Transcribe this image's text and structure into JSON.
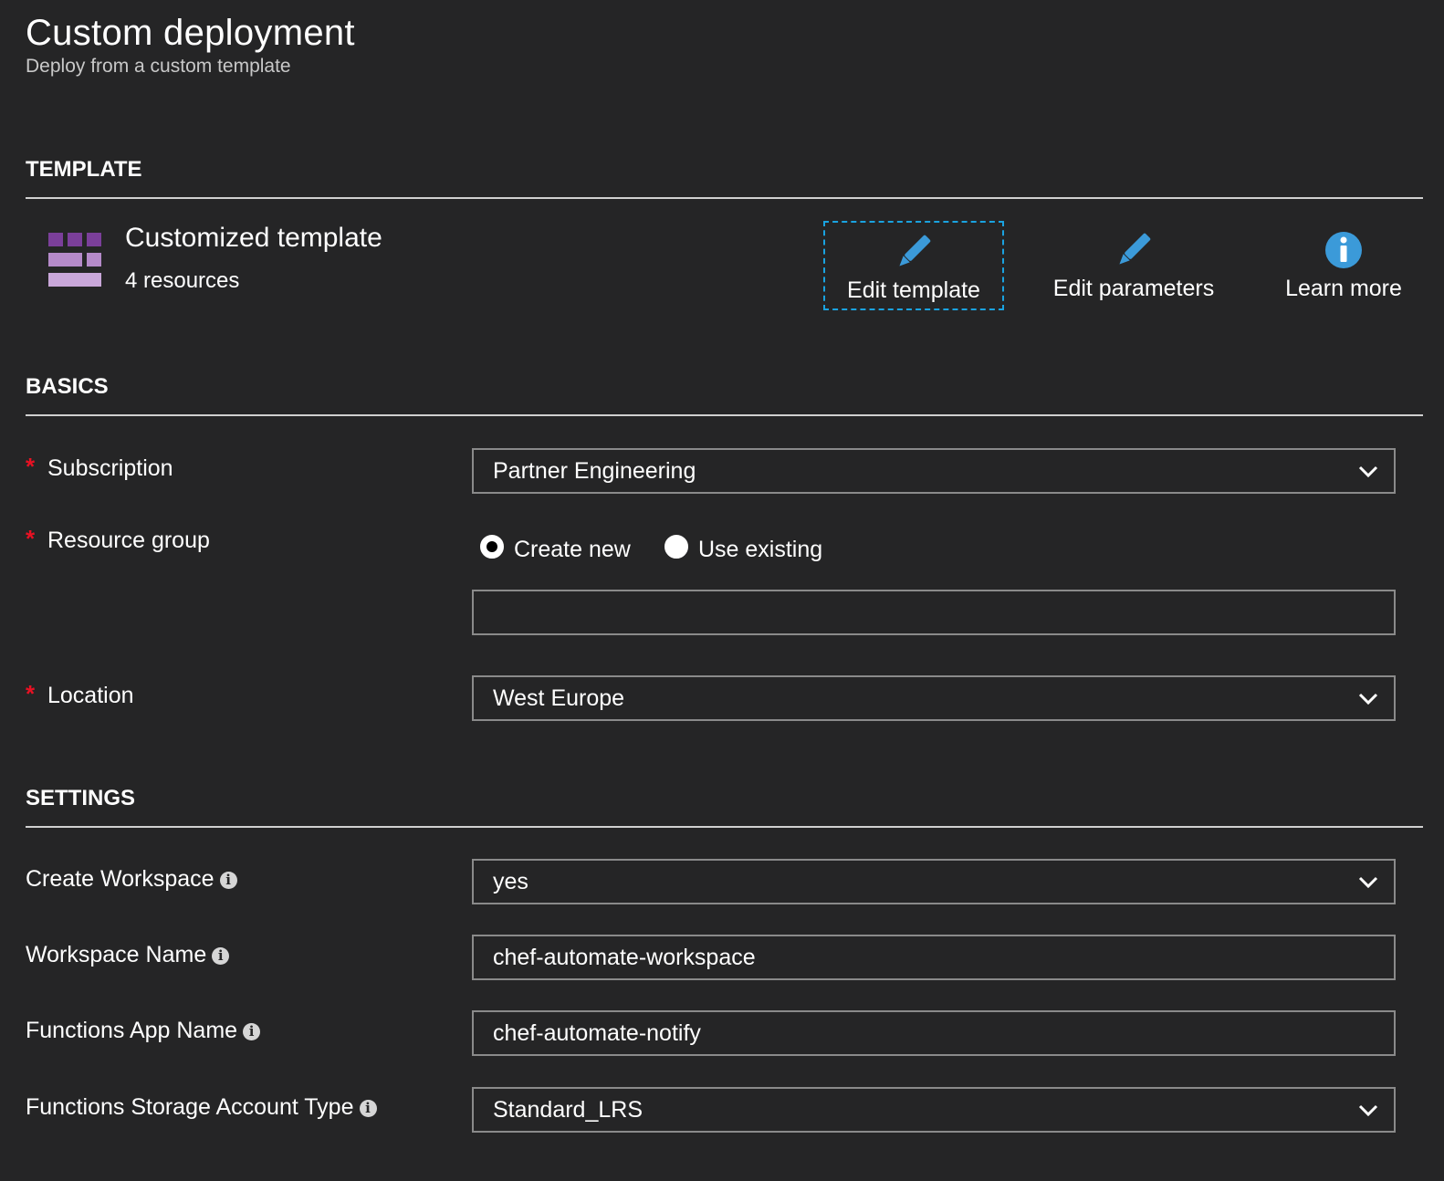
{
  "header": {
    "title": "Custom deployment",
    "subtitle": "Deploy from a custom template"
  },
  "template_section": {
    "heading": "TEMPLATE",
    "name": "Customized template",
    "resources": "4 resources",
    "actions": {
      "edit_template": "Edit template",
      "edit_parameters": "Edit parameters",
      "learn_more": "Learn more"
    }
  },
  "basics": {
    "heading": "BASICS",
    "required_mark": "*",
    "subscription": {
      "label": "Subscription",
      "value": "Partner Engineering"
    },
    "resource_group": {
      "label": "Resource group",
      "option_new": "Create new",
      "option_existing": "Use existing",
      "selected": "Create new",
      "value": ""
    },
    "location": {
      "label": "Location",
      "value": "West Europe"
    }
  },
  "settings": {
    "heading": "SETTINGS",
    "info_glyph": "i",
    "create_workspace": {
      "label": "Create Workspace",
      "value": "yes"
    },
    "workspace_name": {
      "label": "Workspace Name",
      "value": "chef-automate-workspace"
    },
    "functions_app_name": {
      "label": "Functions App Name",
      "value": "chef-automate-notify"
    },
    "storage_account_type": {
      "label": "Functions Storage Account Type",
      "value": "Standard_LRS"
    }
  },
  "colors": {
    "background": "#252526",
    "accent": "#1aa3e0",
    "required": "#e81123",
    "template_icon": "#8e4fa6"
  },
  "icons": [
    "template-grid-icon",
    "pencil-icon",
    "info-icon",
    "chevron-down-icon",
    "info-dot-icon"
  ]
}
